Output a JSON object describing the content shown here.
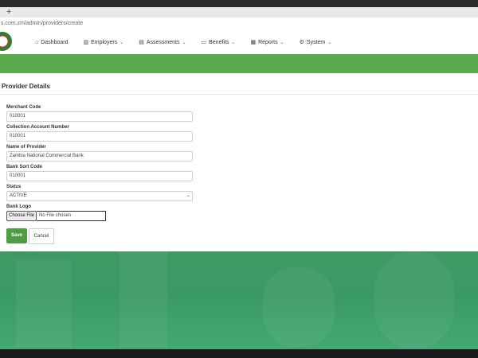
{
  "browser": {
    "new_tab": "+",
    "url": "s.com.zm/admin/providers/create"
  },
  "nav": {
    "items": [
      {
        "label": "Dashboard",
        "icon": "home-icon",
        "glyph": "⌂",
        "dropdown": false
      },
      {
        "label": "Employers",
        "icon": "building-icon",
        "glyph": "▥",
        "dropdown": true
      },
      {
        "label": "Assessments",
        "icon": "document-icon",
        "glyph": "▤",
        "dropdown": true
      },
      {
        "label": "Benefits",
        "icon": "money-icon",
        "glyph": "▭",
        "dropdown": true
      },
      {
        "label": "Reports",
        "icon": "chart-icon",
        "glyph": "▦",
        "dropdown": true
      },
      {
        "label": "System",
        "icon": "gear-icon",
        "glyph": "⚙",
        "dropdown": true
      }
    ],
    "chevron": "⌄"
  },
  "card": {
    "title": "Provider Details"
  },
  "form": {
    "merchant_code": {
      "label": "Merchant Code",
      "value": "010001"
    },
    "collection_account": {
      "label": "Collection Account Number",
      "value": "010001"
    },
    "provider_name": {
      "label": "Name of Provider",
      "value": "Zambia National Commercial Bank"
    },
    "sort_code": {
      "label": "Bank Sort Code",
      "value": "010001"
    },
    "status": {
      "label": "Status",
      "value": "ACTIVE"
    },
    "logo": {
      "label": "Bank Logo",
      "button": "Choose File",
      "status": "No File chosen"
    }
  },
  "actions": {
    "save": "Save",
    "cancel": "Cancel"
  },
  "colors": {
    "brand_green": "#5aab4d",
    "save_green": "#4e9d43",
    "hero_green": "#3e9a62"
  }
}
